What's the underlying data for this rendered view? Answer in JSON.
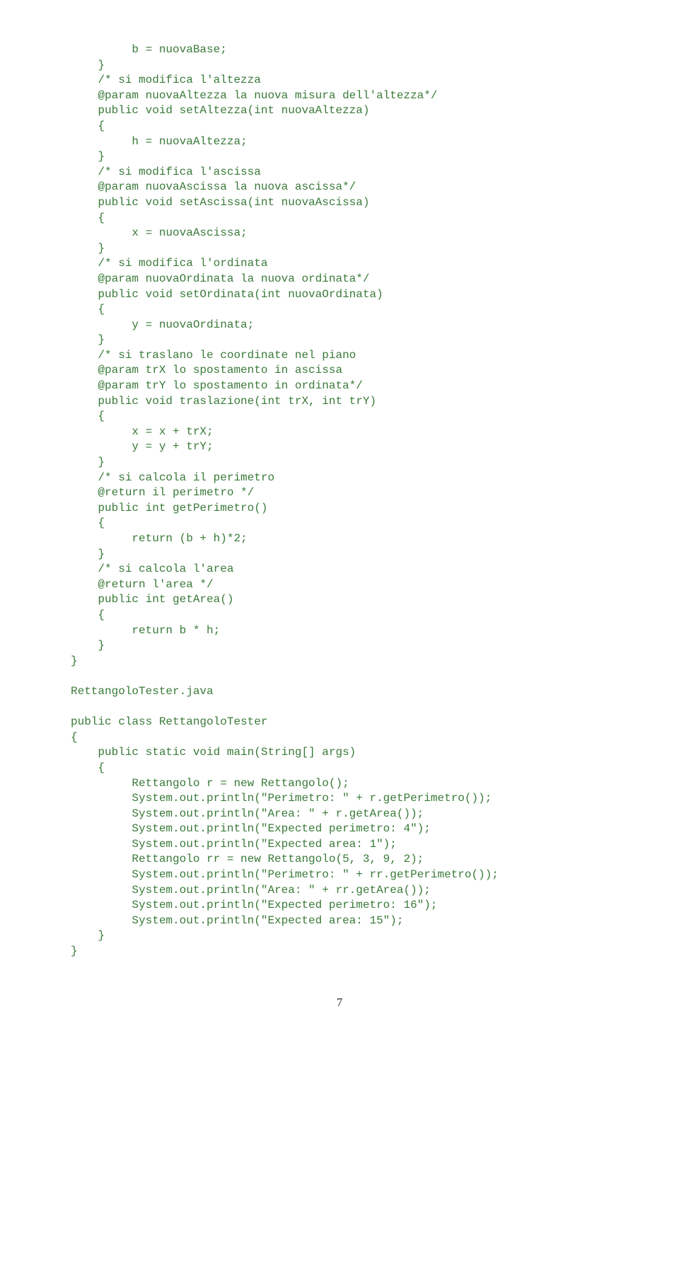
{
  "code": {
    "l0": "         b = nuovaBase;",
    "l1": "    }",
    "l2": "    /* si modifica l'altezza",
    "l3": "    @param nuovaAltezza la nuova misura dell'altezza*/",
    "l4": "    public void setAltezza(int nuovaAltezza)",
    "l5": "    {",
    "l6": "         h = nuovaAltezza;",
    "l7": "    }",
    "l8": "    /* si modifica l'ascissa",
    "l9": "    @param nuovaAscissa la nuova ascissa*/",
    "l10": "    public void setAscissa(int nuovaAscissa)",
    "l11": "    {",
    "l12": "         x = nuovaAscissa;",
    "l13": "    }",
    "l14": "    /* si modifica l'ordinata",
    "l15": "    @param nuovaOrdinata la nuova ordinata*/",
    "l16": "    public void setOrdinata(int nuovaOrdinata)",
    "l17": "    {",
    "l18": "         y = nuovaOrdinata;",
    "l19": "    }",
    "l20": "    /* si traslano le coordinate nel piano",
    "l21": "    @param trX lo spostamento in ascissa",
    "l22": "    @param trY lo spostamento in ordinata*/",
    "l23": "    public void traslazione(int trX, int trY)",
    "l24": "    {",
    "l25": "         x = x + trX;",
    "l26": "         y = y + trY;",
    "l27": "    }",
    "l28": "    /* si calcola il perimetro",
    "l29": "    @return il perimetro */",
    "l30": "    public int getPerimetro()",
    "l31": "    {",
    "l32": "         return (b + h)*2;",
    "l33": "    }",
    "l34": "    /* si calcola l'area",
    "l35": "    @return l'area */",
    "l36": "    public int getArea()",
    "l37": "    {",
    "l38": "         return b * h;",
    "l39": "    }",
    "l40": "}",
    "l41": "",
    "l42": "RettangoloTester.java",
    "l43": "",
    "l44": "public class RettangoloTester",
    "l45": "{",
    "l46": "    public static void main(String[] args)",
    "l47": "    {",
    "l48": "         Rettangolo r = new Rettangolo();",
    "l49": "         System.out.println(\"Perimetro: \" + r.getPerimetro());",
    "l50": "         System.out.println(\"Area: \" + r.getArea());",
    "l51": "         System.out.println(\"Expected perimetro: 4\");",
    "l52": "         System.out.println(\"Expected area: 1\");",
    "l53": "         Rettangolo rr = new Rettangolo(5, 3, 9, 2);",
    "l54": "         System.out.println(\"Perimetro: \" + rr.getPerimetro());",
    "l55": "         System.out.println(\"Area: \" + rr.getArea());",
    "l56": "         System.out.println(\"Expected perimetro: 16\");",
    "l57": "         System.out.println(\"Expected area: 15\");",
    "l58": "    }",
    "l59": "}"
  },
  "pageNumber": "7"
}
